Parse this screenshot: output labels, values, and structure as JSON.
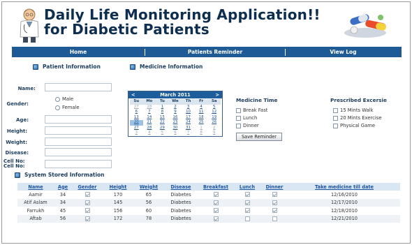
{
  "app": {
    "title_line1": "Daily Life Monitoring Application!!",
    "title_line2": "for Diabetic Patients"
  },
  "nav": {
    "items": [
      {
        "label": "Home"
      },
      {
        "label": "Patients Reminder"
      },
      {
        "label": "View Log"
      }
    ]
  },
  "sections": {
    "patient_info": "Patient Information",
    "medicine_info": "Medicine Information",
    "stored_info": "System Stored Information"
  },
  "form": {
    "name_label": "Name:",
    "gender_label": "Gender:",
    "male_label": "Male",
    "female_label": "Female",
    "age_label": "Age:",
    "height_label": "Height:",
    "weight_label": "Weight:",
    "disease_label": "Disease:",
    "cell_label_1": "Cell No:",
    "cell_label_2": "Cell No:"
  },
  "calendar": {
    "prev": "<",
    "next": ">",
    "month": "March 2011",
    "days_of_week": [
      "Su",
      "Mo",
      "Tu",
      "We",
      "Th",
      "Fr",
      "Sa"
    ],
    "weeks": [
      [
        "27",
        "28",
        "1",
        "2",
        "3",
        "4",
        "5"
      ],
      [
        "6",
        "7",
        "8",
        "9",
        "10",
        "11",
        "12"
      ],
      [
        "13",
        "14",
        "15",
        "16",
        "17",
        "18",
        "19"
      ],
      [
        "20",
        "21",
        "22",
        "23",
        "24",
        "25",
        "26"
      ],
      [
        "27",
        "28",
        "29",
        "30",
        "31",
        "1",
        "2"
      ],
      [
        "3",
        "4",
        "5",
        "6",
        "7",
        "8",
        "9"
      ]
    ]
  },
  "medicine_time": {
    "heading": "Medicine Time",
    "options": [
      "Break Fast",
      "Lunch",
      "Dinner"
    ],
    "save_button": "Save Reminder"
  },
  "exercise": {
    "heading": "Prescribed Excersie",
    "options": [
      "15 Mints Walk",
      "20 Mints Exercise",
      "Physical Game"
    ]
  },
  "table": {
    "headers": [
      "Name",
      "Age",
      "Gender",
      "Height",
      "Weight",
      "Disease",
      "Breakfast",
      "Lunch",
      "Dinner",
      "Take medicine till date"
    ],
    "rows": [
      {
        "name": "Aamir",
        "age": "34",
        "gender": true,
        "height": "170",
        "weight": "65",
        "disease": "Diabetes",
        "breakfast": true,
        "lunch": true,
        "dinner": true,
        "date": "12/16/2010"
      },
      {
        "name": "Atif Aslam",
        "age": "34",
        "gender": true,
        "height": "145",
        "weight": "56",
        "disease": "Diabetes",
        "breakfast": true,
        "lunch": true,
        "dinner": true,
        "date": "12/17/2010"
      },
      {
        "name": "Farrukh",
        "age": "45",
        "gender": true,
        "height": "156",
        "weight": "60",
        "disease": "Diabetes",
        "breakfast": true,
        "lunch": true,
        "dinner": true,
        "date": "12/18/2010"
      },
      {
        "name": "Aftab",
        "age": "56",
        "gender": true,
        "height": "172",
        "weight": "78",
        "disease": "Diabetes",
        "breakfast": true,
        "lunch": false,
        "dinner": false,
        "date": "12/21/2010"
      }
    ]
  },
  "colors": {
    "nav_bar": "#1d5a96",
    "title": "#0d2e4f",
    "header_link": "#1c55a0"
  }
}
